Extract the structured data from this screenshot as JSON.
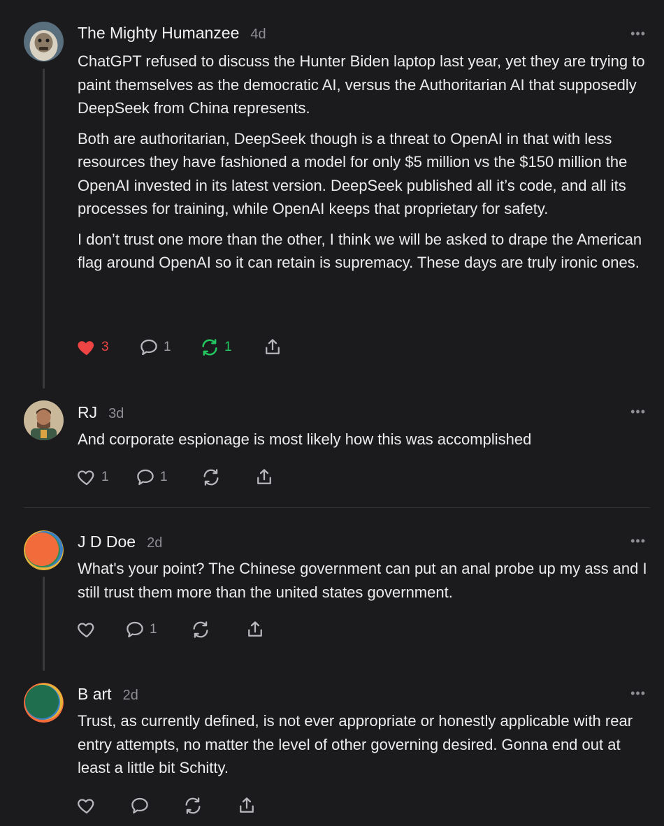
{
  "comments": [
    {
      "author": "The Mighty Humanzee",
      "time": "4d",
      "more": "•••",
      "paragraphs": [
        "ChatGPT refused to discuss the Hunter Biden laptop last year, yet they are trying to paint themselves as the democratic AI, versus the Authoritarian AI that supposedly DeepSeek from China represents.",
        "Both are authoritarian, DeepSeek though is a threat to OpenAI in that with less resources they have fashioned a model for only $5 million vs the $150 million the OpenAI invested in its latest version. DeepSeek published all it’s code, and all its processes for training, while OpenAI keeps that proprietary for safety.",
        "I don’t trust one more than the other, I think we will be asked to drape the American flag around OpenAI so it can retain is supremacy. These days are truly ironic ones."
      ],
      "likes": "3",
      "replies": "1",
      "restacks": "1",
      "liked": true,
      "restacked": true
    },
    {
      "author": "RJ",
      "time": "3d",
      "more": "•••",
      "paragraphs": [
        "And corporate espionage is most likely how this was accomplished"
      ],
      "likes": "1",
      "replies": "1",
      "restacks": "",
      "liked": false,
      "restacked": false
    },
    {
      "author": "J D Doe",
      "time": "2d",
      "more": "•••",
      "paragraphs": [
        "What's your point? The Chinese government can put an anal probe up my ass and I still trust them more than the united states government."
      ],
      "likes": "",
      "replies": "1",
      "restacks": "",
      "liked": false,
      "restacked": false
    },
    {
      "author": "B art",
      "time": "2d",
      "more": "•••",
      "paragraphs": [
        "Trust, as currently defined, is not ever appropriate or honestly applicable with rear entry attempts, no matter the level of other governing desired. Gonna end out at least a little bit Schitty."
      ],
      "likes": "",
      "replies": "",
      "restacks": "",
      "liked": false,
      "restacked": false
    }
  ],
  "colors": {
    "background": "#1b1b1d",
    "like_active": "#ef4444",
    "restack_active": "#22c55e",
    "muted": "#8e8e93"
  },
  "icons": [
    "heart-icon",
    "comment-icon",
    "restack-icon",
    "share-icon",
    "more-icon"
  ]
}
